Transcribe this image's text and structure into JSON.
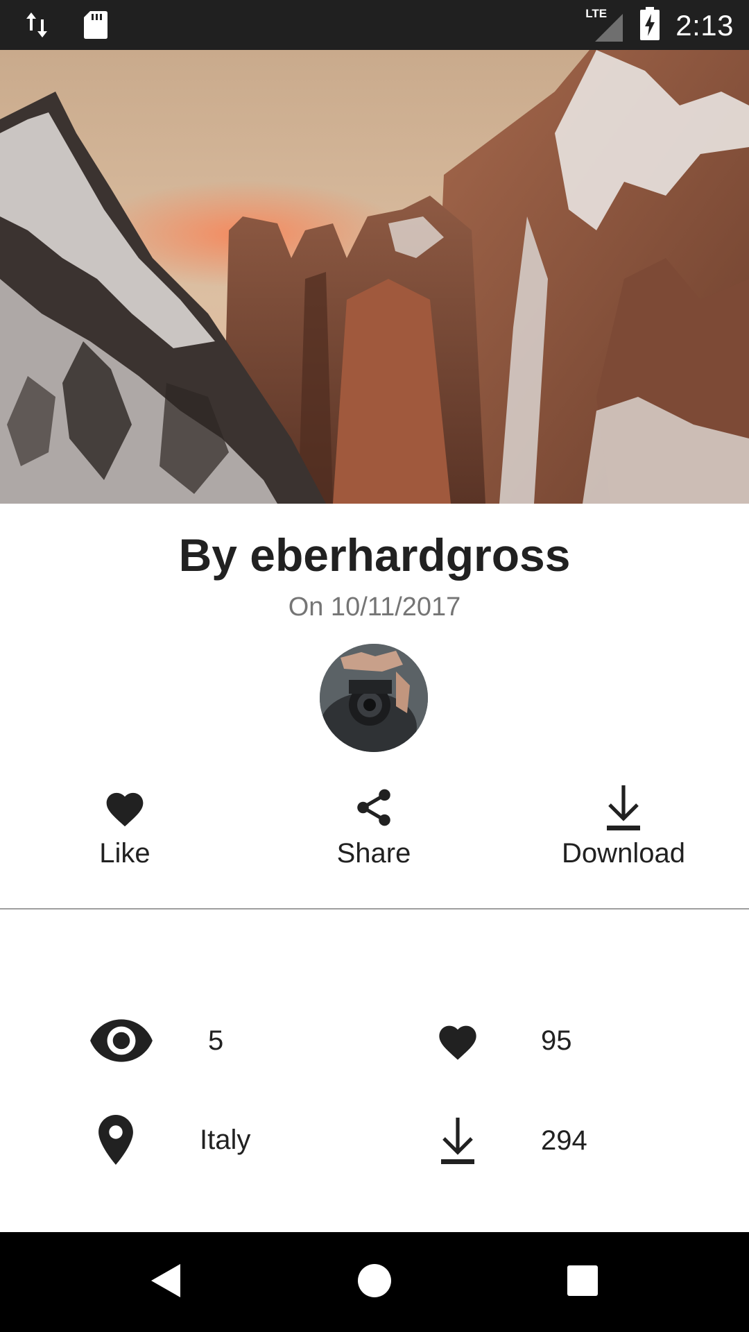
{
  "status_bar": {
    "time": "2:13",
    "network_label": "LTE",
    "icons": [
      "data-transfer-icon",
      "sd-card-icon",
      "signal-icon",
      "battery-charging-icon"
    ]
  },
  "hero": {
    "description_icon": "mountain-photo"
  },
  "author": {
    "title": "By eberhardgross",
    "date": "On 10/11/2017"
  },
  "actions": {
    "like": {
      "label": "Like",
      "icon": "heart-icon"
    },
    "share": {
      "label": "Share",
      "icon": "share-icon"
    },
    "download": {
      "label": "Download",
      "icon": "download-icon"
    }
  },
  "stats": {
    "views": {
      "icon": "eye-icon",
      "value": "5"
    },
    "likes": {
      "icon": "heart-icon",
      "value": "95"
    },
    "location": {
      "icon": "location-pin-icon",
      "value": "Italy"
    },
    "downloads": {
      "icon": "download-icon",
      "value": "294"
    }
  },
  "nav_bar": {
    "icons": [
      "back-icon",
      "home-icon",
      "recents-icon"
    ]
  },
  "colors": {
    "status_bar_bg": "#202020",
    "nav_bar_bg": "#000000",
    "text_primary": "#212121",
    "text_secondary": "#757575",
    "divider": "#9e9e9e"
  }
}
